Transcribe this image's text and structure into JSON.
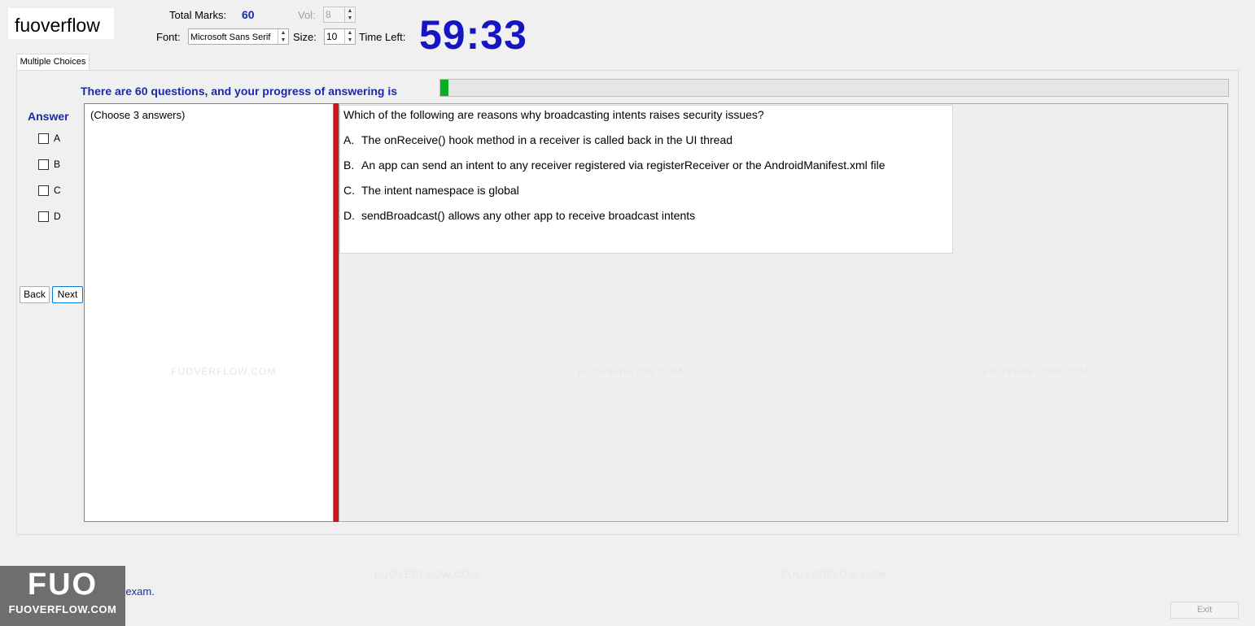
{
  "header": {
    "logo_text": "fuoverflow",
    "total_marks_label": "Total Marks:",
    "total_marks_value": "60",
    "vol_label": "Vol:",
    "vol_value": "8",
    "font_label": "Font:",
    "font_value": "Microsoft Sans Serif",
    "size_label": "Size:",
    "size_value": "10",
    "time_left_label": "Time Left:",
    "time_left_value": "59:33"
  },
  "tabs": [
    {
      "label": "Multiple Choices"
    }
  ],
  "progress": {
    "text": "There are 60 questions, and your progress of answering is",
    "fraction": 0.01
  },
  "answer": {
    "title": "Answer",
    "options": [
      "A",
      "B",
      "C",
      "D"
    ],
    "back_label": "Back",
    "next_label": "Next"
  },
  "question": {
    "hint": "(Choose 3 answers)",
    "text": "Which of the following are reasons why broadcasting intents raises security issues?",
    "options": [
      {
        "letter": "A.",
        "text": "The onReceive() hook method in a receiver is called back in the UI thread"
      },
      {
        "letter": "B.",
        "text": "An app can send an intent to any receiver registered via registerReceiver or the AndroidManifest.xml file"
      },
      {
        "letter": "C.",
        "text": "The intent namespace is global"
      },
      {
        "letter": "D.",
        "text": "sendBroadcast() allows any other app to receive broadcast intents"
      }
    ]
  },
  "watermark": {
    "text": "FUOVERFLOW.COM"
  },
  "footer": {
    "finish_label": "I want to finish the exam.",
    "exit_label": "Exit",
    "badge_big": "FUO",
    "badge_small": "FUOVERFLOW.COM"
  },
  "colors": {
    "accent_blue": "#1a2aa8",
    "timer_blue": "#1515c4",
    "progress_green": "#06b025",
    "splitter_red": "#c8141b"
  }
}
